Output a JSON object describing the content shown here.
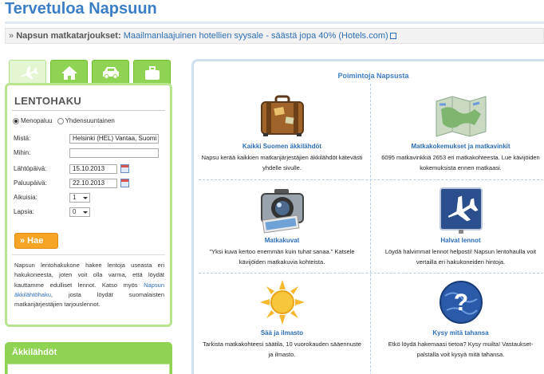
{
  "header": {
    "title": "Tervetuloa Napsuun"
  },
  "offers": {
    "label": "Napsun matkatarjoukset:",
    "link": "Maailmanlaajuinen hotellien syysale - säästä jopa 40% (Hotels.com)"
  },
  "tabs": [
    {
      "name": "flights",
      "icon": "airplane-icon"
    },
    {
      "name": "packages",
      "icon": "house-icon"
    },
    {
      "name": "cars",
      "icon": "car-icon"
    },
    {
      "name": "hotels",
      "icon": "suitcase-icon"
    }
  ],
  "flight_search": {
    "title": "LENTOHAKU",
    "trip_type": {
      "return_label": "Menopaluu",
      "oneway_label": "Yhdensuuntainen",
      "selected": "Menopaluu"
    },
    "from_label": "Mistä:",
    "from_value": "Helsinki (HEL) Vantaa, Suomi",
    "to_label": "Mihin:",
    "to_value": "",
    "depart_label": "Lähtöpäivä:",
    "depart_value": "15.10.2013",
    "return_label": "Paluupäivä:",
    "return_value": "22.10.2013",
    "adults_label": "Aikuisia:",
    "adults_value": "1",
    "children_label": "Lapsia:",
    "children_value": "0",
    "go_button": "» Hae",
    "description_before": "Napsun lentohakukone hakee lentoja useasta eri hakukoneesta, joten voit olla varma, että löydät kauttamme edulliset lennot. Katso myös ",
    "description_link": "Napsun äkkilähtöhaku",
    "description_after": ", josta löydät suomalaisten matkanjärjestäjien tarjouslennot."
  },
  "last_minute": {
    "title": "Äkkilähdöt"
  },
  "picks": {
    "title": "Poimintoja Napsusta",
    "items": [
      {
        "title": "Kaikki Suomen äkkilähdöt",
        "text": "Napsu kerää kaikkien matkanjärjestäjien äkkilähdöt kätevästi yhdelle sivulle.",
        "icon": "suitcase-icon"
      },
      {
        "title": "Matkakokemukset ja matkavinkit",
        "text": "6095 matkavinkkiä 2653 eri matkakohteesta. Lue kävijöiden kokemuksista ennen matkaasi.",
        "icon": "map-icon"
      },
      {
        "title": "Matkakuvat",
        "text": "\"Yksi kuva kertoo enemmän kuin tuhat sanaa.\" Katsele kävijöiden matkakuvia kohteista.",
        "icon": "camera-icon"
      },
      {
        "title": "Halvat lennot",
        "text": "Löydä halvimmat lennot helposti! Napsun lentohaulla voit vertailla eri hakukoneiden hintoja.",
        "icon": "airplane-sign-icon"
      },
      {
        "title": "Sää ja ilmasto",
        "text": "Tarkista matkakohteesi säätila, 10 vuorokauden sääennuste ja ilmasto.",
        "icon": "sun-icon"
      },
      {
        "title": "Kysy mitä tahansa",
        "text": "Etkö löydä hakemaasi tietoa? Kysy muilta! Vastaukset-palstalla voit kysyä mitä tahansa.",
        "icon": "question-globe-icon"
      }
    ]
  }
}
